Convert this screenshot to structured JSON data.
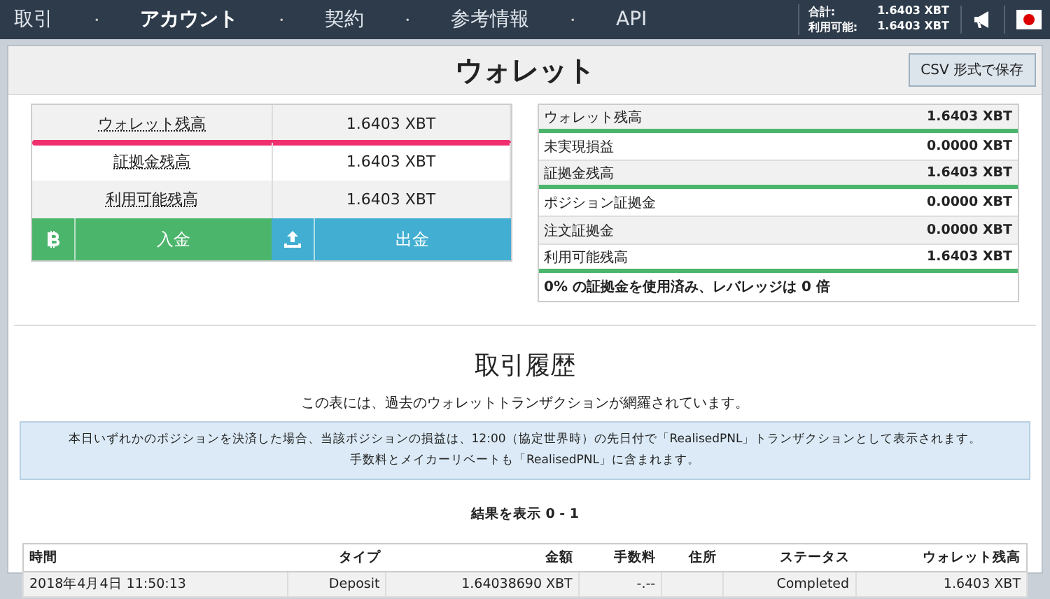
{
  "nav": {
    "items": [
      {
        "label": "取引",
        "selected": false
      },
      {
        "label": "アカウント",
        "selected": true
      },
      {
        "label": "契約",
        "selected": false
      },
      {
        "label": "参考情報",
        "selected": false
      },
      {
        "label": "API",
        "selected": false
      }
    ],
    "separator": "・",
    "balances": [
      {
        "label": "合計:",
        "value": "1.6403 XBT"
      },
      {
        "label": "利用可能:",
        "value": "1.6403 XBT"
      }
    ]
  },
  "page": {
    "title": "ウォレット",
    "csv_button": "CSV 形式で保存"
  },
  "summary": {
    "rows": [
      {
        "label": "ウォレット残高",
        "value": "1.6403 XBT",
        "underlined": true
      },
      {
        "label": "証拠金残高",
        "value": "1.6403 XBT",
        "underlined": false
      },
      {
        "label": "利用可能残高",
        "value": "1.6403 XBT",
        "underlined": false
      }
    ],
    "deposit": "入金",
    "withdraw": "出金"
  },
  "breakdown": {
    "rows": [
      {
        "label": "ウォレット残高",
        "value": "1.6403 XBT",
        "divider": true
      },
      {
        "label": "未実現損益",
        "value": "0.0000 XBT",
        "divider": false
      },
      {
        "label": "証拠金残高",
        "value": "1.6403 XBT",
        "divider": true
      },
      {
        "label": "ポジション証拠金",
        "value": "0.0000 XBT",
        "divider": false
      },
      {
        "label": "注文証拠金",
        "value": "0.0000 XBT",
        "divider": false
      },
      {
        "label": "利用可能残高",
        "value": "1.6403 XBT",
        "divider": true
      }
    ],
    "footer": "0% の証拠金を使用済み、レバレッジは 0 倍"
  },
  "history": {
    "title": "取引履歴",
    "description": "この表には、過去のウォレットトランザクションが網羅されています。",
    "notice": [
      "本日いずれかのポジションを決済した場合、当該ポジションの損益は、12:00（協定世界時）の先日付で「RealisedPNL」トランザクションとして表示されます。",
      "手数料とメイカーリベートも「RealisedPNL」に含まれます。"
    ],
    "results": "結果を表示 0 - 1",
    "table": {
      "columns": [
        "時間",
        "タイプ",
        "金額",
        "手数料",
        "住所",
        "ステータス",
        "ウォレット残高"
      ],
      "rows": [
        [
          "2018年4月4日 11:50:13",
          "Deposit",
          "1.64038690 XBT",
          "-.--",
          "",
          "Completed",
          "1.6403 XBT"
        ]
      ]
    }
  }
}
